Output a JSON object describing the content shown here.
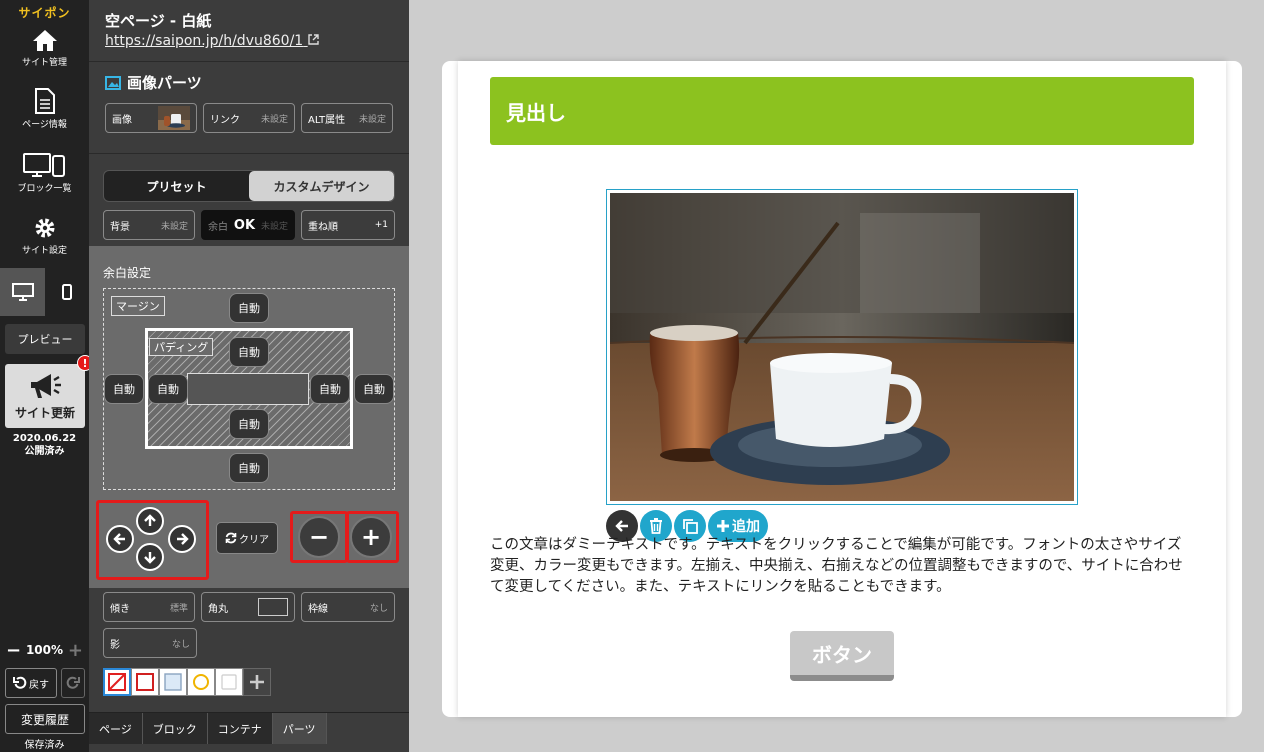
{
  "nav": {
    "brand": "サイポン",
    "site_manage": "サイト管理",
    "page_info": "ページ情報",
    "block_list": "ブロック一覧",
    "site_settings": "サイト設定",
    "preview": "プレビュー",
    "site_update": "サイト更新",
    "alert": "!",
    "pub_date": "2020.06.22",
    "pub_status": "公開済み",
    "zoom": "100%",
    "undo": "戻す",
    "history": "変更履歴",
    "saved": "保存済み"
  },
  "panel": {
    "page_title": "空ページ - 白紙",
    "page_url": "https://saipon.jp/h/dvu860/1",
    "section_title": "画像パーツ",
    "image_label": "画像",
    "link_label": "リンク",
    "link_value": "未設定",
    "alt_label": "ALT属性",
    "alt_value": "未設定",
    "tab_preset": "プリセット",
    "tab_custom": "カスタムデザイン",
    "bg_label": "背景",
    "bg_value": "未設定",
    "space_label": "余白",
    "space_value": "OK",
    "space_sub": "未設定",
    "layer_label": "重ね順",
    "layer_value": "+1",
    "spacing_title": "余白設定",
    "margin_label": "マージン",
    "padding_label": "パディング",
    "auto": "自動",
    "clear": "クリア",
    "minus": "−",
    "plus": "+",
    "tilt_label": "傾き",
    "tilt_value": "標準",
    "radius_label": "角丸",
    "border_label": "枠線",
    "border_value": "なし",
    "shadow_label": "影",
    "shadow_value": "なし",
    "tabs": [
      "ページ",
      "ブロック",
      "コンテナ",
      "パーツ"
    ]
  },
  "canvas": {
    "heading": "見出し",
    "add": "追加",
    "body": "この文章はダミーテキストです。テキストをクリックすることで編集が可能です。フォントの太さやサイズ変更、カラー変更もできます。左揃え、中央揃え、右揃えなどの位置調整もできますので、サイトに合わせて変更してください。また、テキストにリンクを貼ることもできます。",
    "button": "ボタン"
  },
  "colors": {
    "accent_green": "#8cc21f",
    "toolbar_blue": "#20a6cc",
    "highlight_red": "#e41b1b"
  }
}
